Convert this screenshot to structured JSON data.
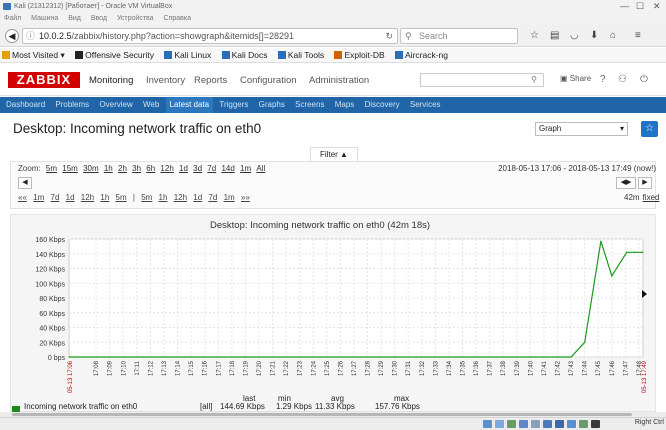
{
  "vbox": {
    "title": "Kali (21312312) [Работает] - Oracle VM VirtualBox",
    "menu": [
      "Файл",
      "Машина",
      "Вид",
      "Ввод",
      "Устройства",
      "Справка"
    ],
    "minimize": "—",
    "maximize": "☐",
    "close": "✕",
    "host_key": "Right Ctrl"
  },
  "browser": {
    "url_host": "10.0.2.5",
    "url_path": "/zabbix/history.php?action=showgraph&itemids[]=28291",
    "search_placeholder": "Search",
    "bookmarks": [
      {
        "label": "Most Visited ▾",
        "icon": "star-folder-icon",
        "color": "#e8a000"
      },
      {
        "label": "Offensive Security",
        "icon": "offsec-icon",
        "color": "#222222"
      },
      {
        "label": "Kali Linux",
        "icon": "kali-dragon-icon",
        "color": "#2a6fb5"
      },
      {
        "label": "Kali Docs",
        "icon": "kali-dragon-icon",
        "color": "#2a6fb5"
      },
      {
        "label": "Kali Tools",
        "icon": "kali-dragon-icon",
        "color": "#2a6fb5"
      },
      {
        "label": "Exploit-DB",
        "icon": "exploitdb-icon",
        "color": "#d06000"
      },
      {
        "label": "Aircrack-ng",
        "icon": "aircrack-icon",
        "color": "#2a6fb5"
      }
    ]
  },
  "zabbix": {
    "logo": "ZABBIX",
    "top_menu": [
      "Monitoring",
      "Inventory",
      "Reports",
      "Configuration",
      "Administration"
    ],
    "share_label": "Share",
    "sub_menu": [
      "Dashboard",
      "Problems",
      "Overview",
      "Web",
      "Latest data",
      "Triggers",
      "Graphs",
      "Screens",
      "Maps",
      "Discovery",
      "Services"
    ],
    "active_sub": "Latest data",
    "accent": "#d40000",
    "subnav_color": "#1f65a8"
  },
  "page": {
    "title": "Desktop: Incoming network traffic on eth0",
    "view_select": "Graph",
    "filter_label": "Filter ▲",
    "zoom_label": "Zoom:",
    "zoom_options": [
      "5m",
      "15m",
      "30m",
      "1h",
      "2h",
      "3h",
      "6h",
      "12h",
      "1d",
      "3d",
      "7d",
      "14d",
      "1m",
      "All"
    ],
    "time_range": "2018-05-13 17:06 - 2018-05-13 17:49 (now!)",
    "period_back": [
      "««",
      "1m",
      "7d",
      "1d",
      "12h",
      "1h",
      "5m",
      "|",
      "5m",
      "1h",
      "12h",
      "1d",
      "7d",
      "1m",
      "»»"
    ],
    "period_value": "42m",
    "fixed_label": "fixed"
  },
  "chart_data": {
    "type": "line",
    "title": "Desktop: Incoming network traffic on eth0 (42m 18s)",
    "y_ticks": [
      "160 Kbps",
      "140 Kbps",
      "120 Kbps",
      "100 Kbps",
      "80 Kbps",
      "60 Kbps",
      "40 Kbps",
      "20 Kbps",
      "0 bps"
    ],
    "ylim": [
      0,
      160
    ],
    "x_start_label": "05-13 17:06",
    "x_end_label": "05-13 17:49",
    "x_ticks": [
      "17:08",
      "17:09",
      "17:10",
      "17:11",
      "17:12",
      "17:13",
      "17:14",
      "17:15",
      "17:16",
      "17:17",
      "17:18",
      "17:19",
      "17:20",
      "17:21",
      "17:22",
      "17:23",
      "17:24",
      "17:25",
      "17:26",
      "17:27",
      "17:28",
      "17:29",
      "17:30",
      "17:31",
      "17:32",
      "17:33",
      "17:34",
      "17:35",
      "17:36",
      "17:37",
      "17:38",
      "17:39",
      "17:40",
      "17:41",
      "17:42",
      "17:43",
      "17:44",
      "17:45",
      "17:46",
      "17:47",
      "17:48"
    ],
    "series": [
      {
        "name": "Incoming network traffic on eth0",
        "color": "#1a9a1a",
        "x": [
          0,
          37.0,
          38.0,
          39.2,
          40.0,
          41.1,
          41.7,
          42.3
        ],
        "values": [
          0,
          0,
          20,
          157,
          110,
          142,
          142,
          142
        ]
      }
    ],
    "legend": {
      "item_label": "Incoming network traffic on eth0",
      "fn": "[all]",
      "headers": [
        "last",
        "min",
        "avg",
        "max"
      ],
      "values": [
        "144.69 Kbps",
        "1.29 Kbps",
        "11.33 Kbps",
        "157.76 Kbps"
      ]
    }
  }
}
